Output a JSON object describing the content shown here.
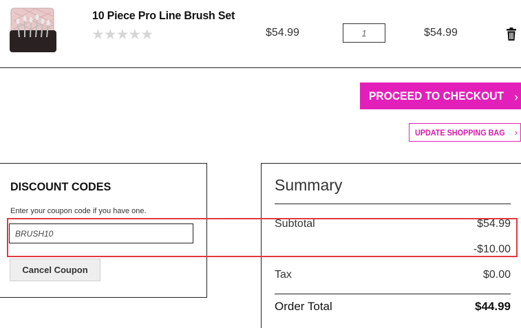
{
  "cart_item": {
    "name": "10 Piece Pro Line Brush Set",
    "rating_stars": "★★★★★",
    "rating_value": 0,
    "price": "$54.99",
    "quantity": "1",
    "line_total": "$54.99",
    "remove_icon": "trash-icon",
    "thumbnail": "brush-set-product-image"
  },
  "actions": {
    "checkout_label": "PROCEED TO CHECKOUT",
    "checkout_chevron": "›",
    "update_label": "UPDATE SHOPPING BAG",
    "update_chevron": "›"
  },
  "discount": {
    "title": "DISCOUNT CODES",
    "hint": "Enter your coupon code if you have one.",
    "coupon_value": "BRUSH10",
    "cancel_label": "Cancel Coupon"
  },
  "summary": {
    "title": "Summary",
    "subtotal_label": "Subtotal",
    "subtotal_value": "$54.99",
    "discount_value": "-$10.00",
    "tax_label": "Tax",
    "tax_value": "$0.00",
    "order_total_label": "Order Total",
    "order_total_value": "$44.99"
  },
  "colors": {
    "accent": "#e31fb9",
    "highlight": "#e0393f"
  }
}
